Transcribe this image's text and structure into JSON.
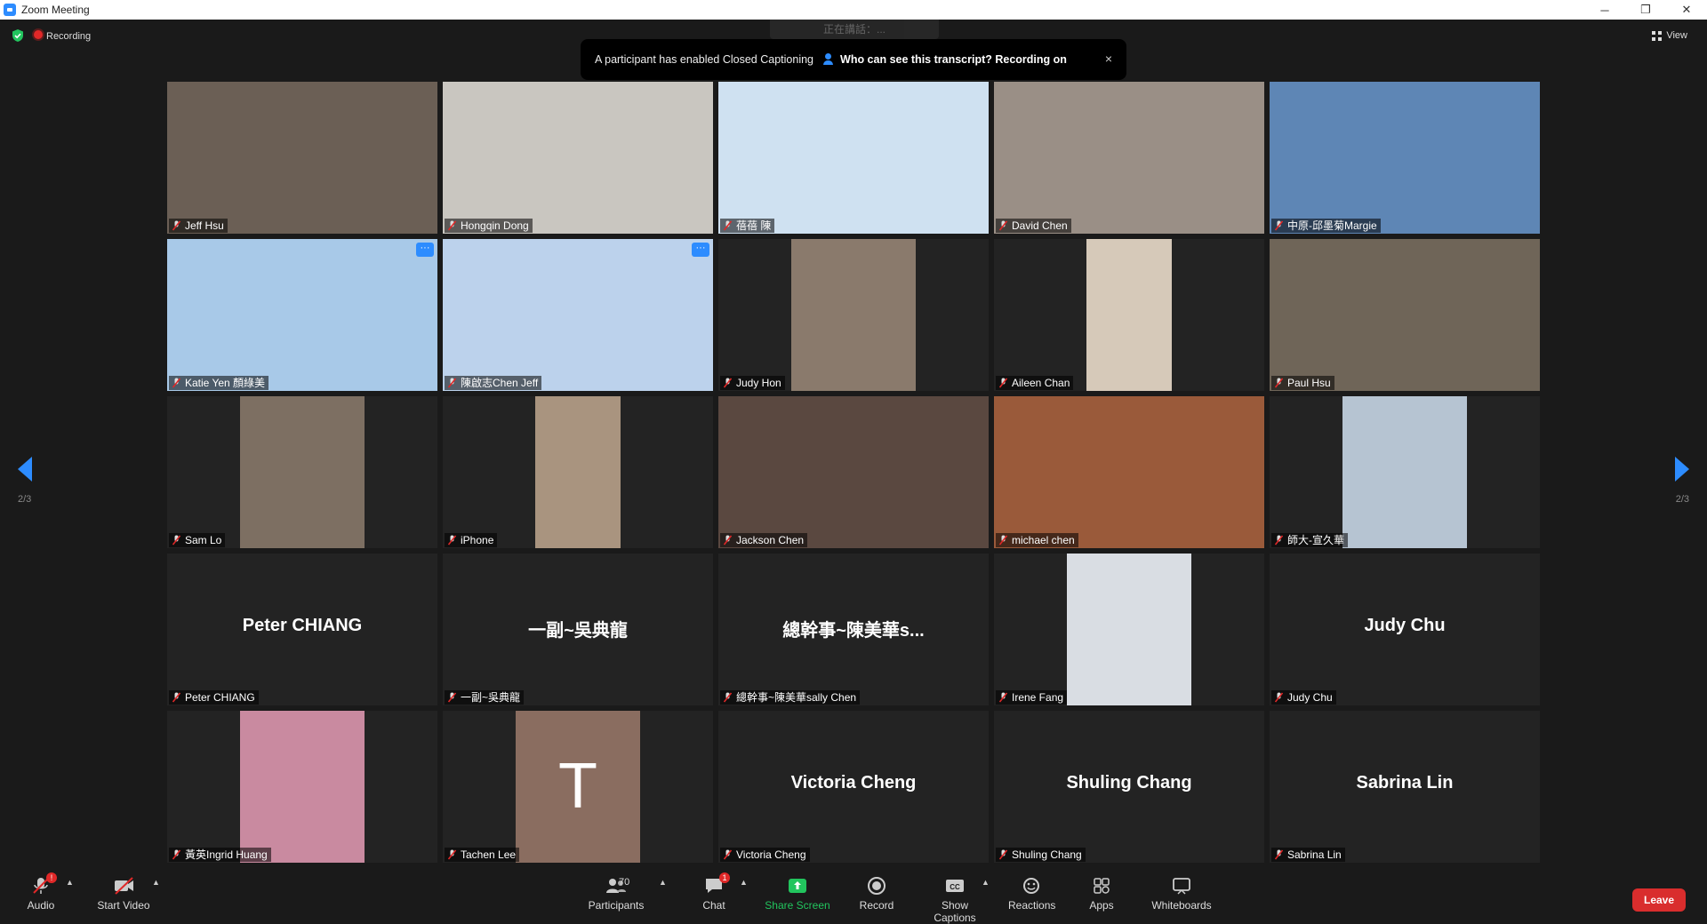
{
  "window": {
    "title": "Zoom Meeting",
    "controls": [
      "─",
      "❐",
      "✕"
    ]
  },
  "status": {
    "recording": "Recording",
    "view": "View"
  },
  "talking_hint": "正在講話：...",
  "banner": {
    "message": "A participant has enabled Closed Captioning",
    "link": "Who can see this transcript? Recording on",
    "close": "×"
  },
  "pagination": {
    "left": "2/3",
    "right": "2/3"
  },
  "tiles": [
    {
      "label": "Jeff Hsu",
      "big": "",
      "bg": "#6b5f55"
    },
    {
      "label": "Hongqin Dong",
      "big": "",
      "bg": "#c9c6c0"
    },
    {
      "label": "蓓蓓 陳",
      "big": "",
      "bg": "#cfe1f1"
    },
    {
      "label": "David Chen",
      "big": "",
      "bg": "#9a8f86"
    },
    {
      "label": "中原-邱墨菊Margie",
      "big": "",
      "bg": "#5e86b5"
    },
    {
      "label": "Katie Yen 顏綠美",
      "big": "",
      "bg": "#a8c9e8",
      "more": "···"
    },
    {
      "label": "陳啟志Chen Jeff",
      "big": "",
      "bg": "#bcd2ec",
      "more": "···"
    },
    {
      "label": "Judy Hon",
      "big": "",
      "bg": "#232323"
    },
    {
      "label": "Aileen Chan",
      "big": "",
      "bg": "#232323"
    },
    {
      "label": "Paul Hsu",
      "big": "",
      "bg": "#6f6558"
    },
    {
      "label": "Sam Lo",
      "big": "",
      "bg": "#232323"
    },
    {
      "label": "iPhone",
      "big": "",
      "bg": "#232323"
    },
    {
      "label": "Jackson Chen",
      "big": "",
      "bg": "#5a4840"
    },
    {
      "label": "michael chen",
      "big": "",
      "bg": "#9a5a3a"
    },
    {
      "label": "師大-宣久華",
      "big": "",
      "bg": "#232323"
    },
    {
      "label": "Peter CHIANG",
      "big": "Peter CHIANG",
      "bg": "#232323"
    },
    {
      "label": "一副~吳典龍",
      "big": "一副~吳典龍",
      "bg": "#232323"
    },
    {
      "label": "總幹事~陳美華sally Chen",
      "big": "總幹事~陳美華s...",
      "bg": "#232323"
    },
    {
      "label": "Irene Fang",
      "big": "",
      "bg": "#232323"
    },
    {
      "label": "Judy Chu",
      "big": "Judy Chu",
      "bg": "#232323"
    },
    {
      "label": "黃英Ingrid Huang",
      "big": "",
      "bg": "#232323"
    },
    {
      "label": "Tachen Lee",
      "big": "",
      "bg": "#232323",
      "avatar_letter": "T"
    },
    {
      "label": "Victoria Cheng",
      "big": "Victoria Cheng",
      "bg": "#232323"
    },
    {
      "label": "Shuling Chang",
      "big": "Shuling Chang",
      "bg": "#232323"
    },
    {
      "label": "Sabrina Lin",
      "big": "Sabrina Lin",
      "bg": "#232323"
    }
  ],
  "toolbar": {
    "audio": "Audio",
    "start_video": "Start Video",
    "participants": "Participants",
    "participants_count": "70",
    "chat": "Chat",
    "chat_badge": "1",
    "audio_badge": "!",
    "share_screen": "Share Screen",
    "record": "Record",
    "show_captions": "Show Captions",
    "reactions": "Reactions",
    "apps": "Apps",
    "whiteboards": "Whiteboards",
    "leave": "Leave"
  },
  "colors": {
    "accent": "#2d8cff",
    "leave": "#d92d2d",
    "share": "#22c55e",
    "recording": "#e02828"
  }
}
